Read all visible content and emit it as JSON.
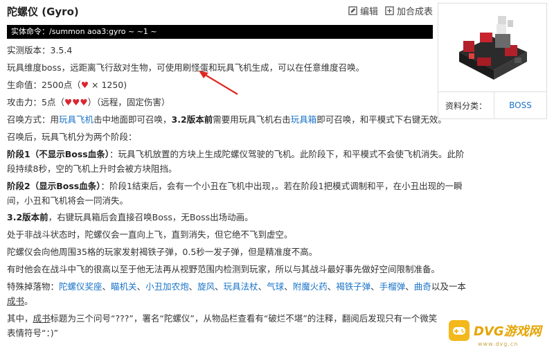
{
  "page": {
    "title": "陀螺仪 (Gyro)",
    "edit_label": "编辑",
    "add_label": "加合成表",
    "command": "实体命令：/summon aoa3:gyro ~ ~1 ~"
  },
  "content": {
    "version": "实测版本：3.5.4",
    "intro": "玩具维度boss，远距离飞行敌对生物，可使用刷怪蛋和玩具飞机生成，可以在任意维度召唤。",
    "hp_prefix": "生命值：2500点（",
    "hp_suffix": " × 1250)",
    "atk_prefix": "攻击力：5点（",
    "atk_suffix": "）（远程，固定伤害）",
    "summon_a": "召唤方式：用",
    "summon_link1": "玩具飞机",
    "summon_b": "击中地面即可召唤，",
    "summon_bold": "3.2版本前",
    "summon_c": "需要用玩具飞机右击",
    "summon_link2": "玩具箱",
    "summon_d": "即可召唤，和平模式下右键无效。",
    "after_summon": "召唤后，玩具飞机分为两个阶段：",
    "stage1_bold": "阶段1（不显示Boss血条）",
    "stage1_a": "：玩具飞机放置的方块上生成陀螺仪驾驶的飞机。此阶段下，和平模式不会使飞机消失。此阶",
    "stage1_b": "段持续8秒，空的飞机上升时会被方块阻挡。",
    "stage2_bold": "阶段2（显示Boss血条）",
    "stage2_a": "：阶段1结束后，会有一个小丑在飞机中出现，。若在阶段1把模式调制和平，在小丑出现的一瞬",
    "stage2_b": "间，小丑和飞机将会一同消失。",
    "v32_bold": "3.2版本前",
    "v32_rest": "，右键玩具箱后会直接召唤Boss，无Boss出场动画。",
    "nonbattle": "处于非战斗状态时，陀螺仪会一直向上飞，直到消失，但它绝不飞到虚空。",
    "shoot": "陀螺仪会向他周围35格的玩家发射褐铁子弹，0.5秒一发子弹，但是精准度不高。",
    "highfly": "有时他会在战斗中飞的很高以至于他无法再从视野范围内检测到玩家，所以与其战斗最好事先做好空间限制准备。",
    "drops_prefix": "特殊掉落物：",
    "drops": [
      "陀螺仪奖座",
      "瞄机关",
      "小丑加农炮",
      "旋风",
      "玩具法杖",
      "气球",
      "附魔火药",
      "褐铁子弹",
      "手榴弹",
      "曲奇"
    ],
    "drops_sep": "、",
    "drops_suffix": "以及一本",
    "book_link": "成书",
    "book_end": "。",
    "final_a": "其中，",
    "final_link": "成书",
    "final_b": "标题为三个问号“???”，署名“陀螺仪”，从物品栏查看有“破烂不堪”的注释，翻阅后发现只有一个微笑",
    "final_c": "表情符号“：)”"
  },
  "infobox": {
    "label": "资料分类：",
    "value": "BOSS"
  },
  "watermark": {
    "text": "DVG游戏网",
    "sub": "www.dvg.cn"
  },
  "colors": {
    "link": "#1a73c8",
    "heart": "#d9262f",
    "arrow": "#e0261f",
    "command_bg": "#000000"
  }
}
